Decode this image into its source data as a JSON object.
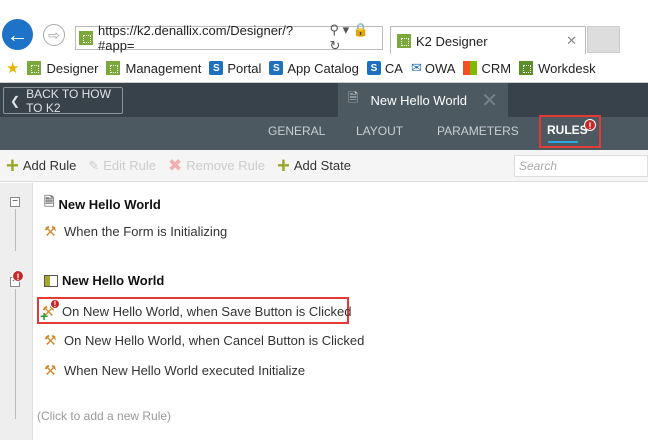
{
  "browser": {
    "url": "https://k2.denallix.com/Designer/?#app=",
    "tab_title": "K2 Designer",
    "favorites": [
      {
        "label": "Designer",
        "icon": "k2-icon"
      },
      {
        "label": "Management",
        "icon": "k2-icon"
      },
      {
        "label": "Portal",
        "icon": "sharepoint-icon"
      },
      {
        "label": "App Catalog",
        "icon": "sharepoint-icon"
      },
      {
        "label": "CA",
        "icon": "sharepoint-icon"
      },
      {
        "label": "OWA",
        "icon": "mail-icon"
      },
      {
        "label": "CRM",
        "icon": "windows-icon"
      },
      {
        "label": "Workdesk",
        "icon": "workdesk-icon"
      }
    ]
  },
  "header": {
    "back_label": "BACK TO HOW TO K2",
    "form_tab": "New Hello World"
  },
  "nav": {
    "tabs": [
      "GENERAL",
      "LAYOUT",
      "PARAMETERS",
      "RULES"
    ],
    "active": "RULES"
  },
  "toolbar": {
    "add_rule": "Add Rule",
    "edit_rule": "Edit Rule",
    "remove_rule": "Remove Rule",
    "add_state": "Add State",
    "search_placeholder": "Search"
  },
  "groups": [
    {
      "title": "New Hello World",
      "rules": [
        "When the Form is Initializing"
      ]
    },
    {
      "title": "New Hello World",
      "rules": [
        "On New Hello World, when Save Button is Clicked",
        "On New Hello World, when Cancel Button is Clicked",
        "When New Hello World executed Initialize"
      ]
    }
  ],
  "add_rule_hint": "(Click to add a new Rule)",
  "colors": {
    "accent": "#2aa6e0",
    "error": "#e53935",
    "header": "#37424a"
  }
}
